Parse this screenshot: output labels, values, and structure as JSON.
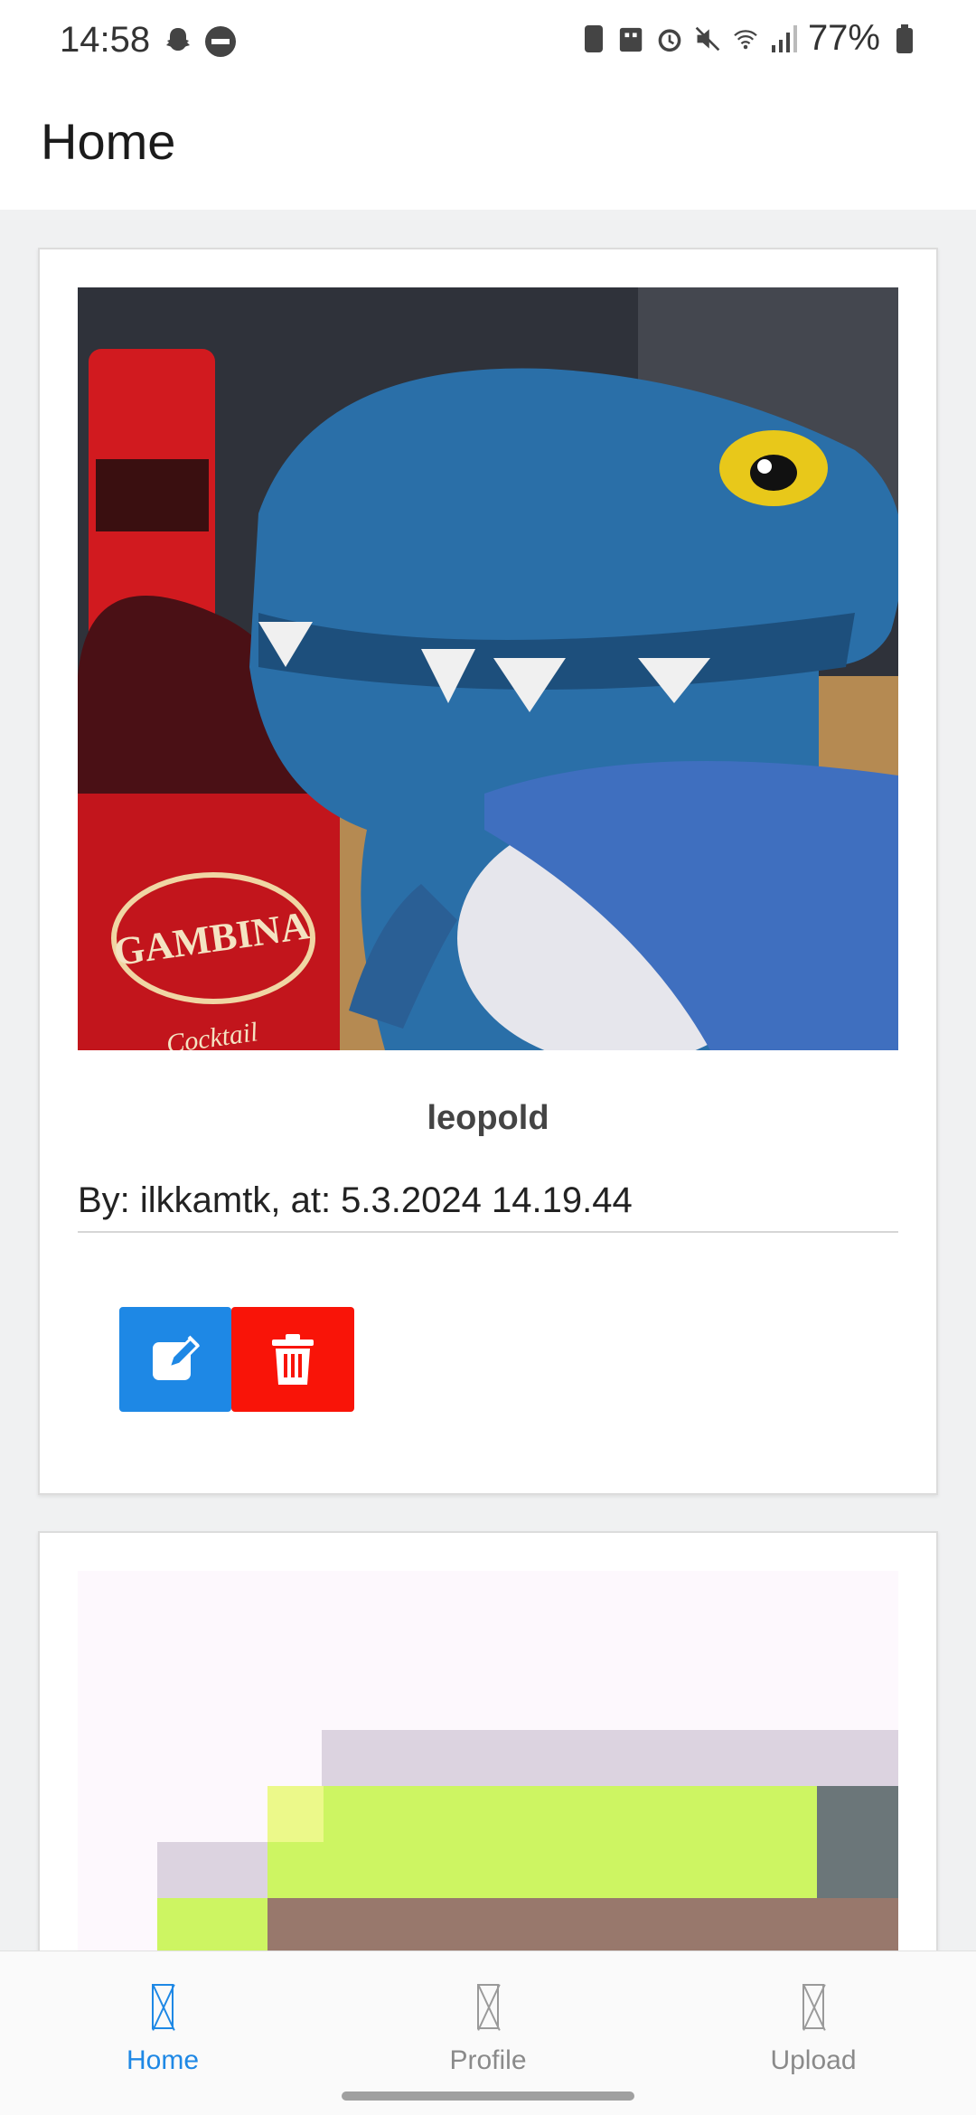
{
  "status_bar": {
    "time": "14:58",
    "battery": "77%",
    "icons": [
      "snapchat-icon",
      "do-not-disturb-icon",
      "sim-icon",
      "building-icon",
      "alarm-icon",
      "mute-icon",
      "wifi-icon",
      "signal-icon",
      "battery-icon"
    ]
  },
  "app_bar": {
    "title": "Home"
  },
  "posts": [
    {
      "title": "leopold",
      "byline": "By: ilkkamtk, at: 5.3.2024 14.19.44",
      "photo_text": "GAMBINA",
      "photo_subtext": "Cocktail",
      "edit_icon": "edit-icon",
      "delete_icon": "trash-icon"
    }
  ],
  "bottom_nav": {
    "items": [
      {
        "label": "Home",
        "active": true
      },
      {
        "label": "Profile",
        "active": false
      },
      {
        "label": "Upload",
        "active": false
      }
    ]
  },
  "colors": {
    "accent": "#1e88e5",
    "delete": "#f91408"
  }
}
